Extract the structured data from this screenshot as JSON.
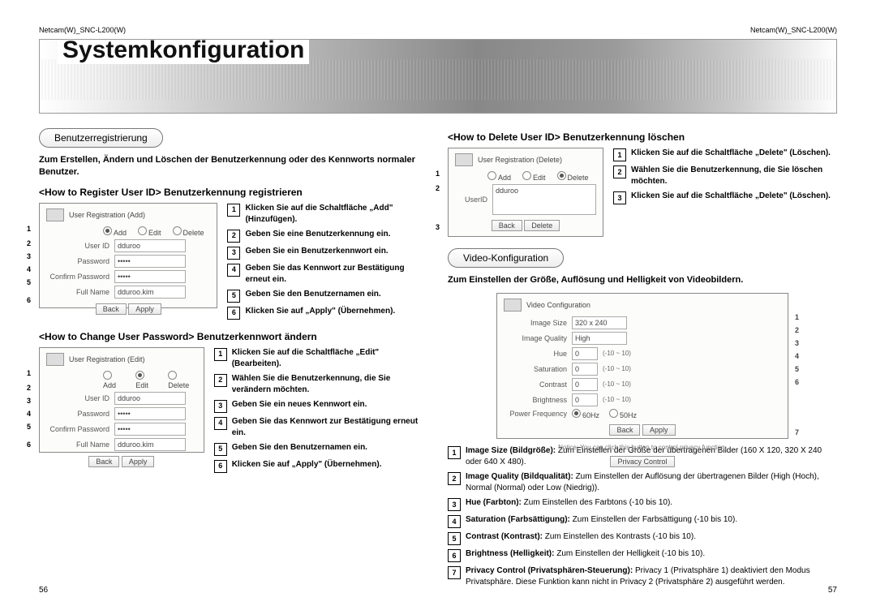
{
  "header": {
    "left": "Netcam(W)_SNC-L200(W)",
    "right": "Netcam(W)_SNC-L200(W)"
  },
  "banner": {
    "title": "Systemkonfiguration"
  },
  "left": {
    "tag": "Benutzerregistrierung",
    "intro": "Zum Erstellen, Ändern und Löschen der Benutzerkennung oder des Kennworts normaler Benutzer.",
    "register": {
      "heading": "<How to Register User ID> Benutzerkennung registrieren",
      "shot": {
        "title": "User Registration (Add)",
        "radios": {
          "add": "Add",
          "edit": "Edit",
          "delete": "Delete"
        },
        "labels": {
          "userid": "User ID",
          "password": "Password",
          "confirm": "Confirm Password",
          "fullname": "Full Name"
        },
        "values": {
          "userid": "dduroo",
          "password": "•••••",
          "confirm": "•••••",
          "fullname": "dduroo.kim"
        },
        "buttons": {
          "back": "Back",
          "apply": "Apply"
        }
      },
      "steps": [
        "Klicken Sie auf die Schaltfläche „Add\" (Hinzufügen).",
        "Geben Sie eine Benutzerkennung ein.",
        "Geben Sie ein Benutzerkennwort ein.",
        "Geben Sie das Kennwort zur Bestätigung erneut ein.",
        "Geben Sie den Benutzernamen ein.",
        "Klicken Sie auf „Apply\" (Übernehmen)."
      ]
    },
    "change": {
      "heading": "<How to Change User Password> Benutzerkennwort ändern",
      "shot": {
        "title": "User Registration (Edit)",
        "radios": {
          "add": "Add",
          "edit": "Edit",
          "delete": "Delete"
        },
        "labels": {
          "userid": "User ID",
          "password": "Password",
          "confirm": "Confirm Password",
          "fullname": "Full Name"
        },
        "values": {
          "userid": "dduroo",
          "password": "•••••",
          "confirm": "•••••",
          "fullname": "dduroo.kim"
        },
        "buttons": {
          "back": "Back",
          "apply": "Apply"
        }
      },
      "steps": [
        "Klicken Sie auf die Schaltfläche „Edit\" (Bearbeiten).",
        "Wählen Sie die Benutzerkennung, die Sie verändern möchten.",
        "Geben Sie ein neues Kennwort ein.",
        "Geben Sie das Kennwort zur Bestätigung erneut ein.",
        "Geben Sie den Benutzernamen ein.",
        "Klicken Sie auf „Apply\" (Übernehmen)."
      ]
    },
    "pagenum": "56"
  },
  "right": {
    "delete": {
      "heading": "<How to Delete User ID> Benutzerkennung löschen",
      "shot": {
        "title": "User Registration (Delete)",
        "radios": {
          "add": "Add",
          "edit": "Edit",
          "delete": "Delete"
        },
        "labels": {
          "userid": "UserID"
        },
        "values": {
          "userid": "dduroo"
        },
        "buttons": {
          "back": "Back",
          "delete": "Delete"
        }
      },
      "steps": [
        "Klicken Sie auf die Schaltfläche „Delete\" (Löschen).",
        "Wählen Sie die Benutzerkennung, die Sie löschen möchten.",
        "Klicken Sie auf die Schaltfläche „Delete\" (Löschen)."
      ]
    },
    "video": {
      "tag": "Video-Konfiguration",
      "intro": "Zum Einstellen der Größe, Auflösung und Helligkeit von Videobildern.",
      "shot": {
        "title": "Video Configuration",
        "labels": {
          "imgsize": "Image Size",
          "imgqual": "Image Quality",
          "hue": "Hue",
          "sat": "Saturation",
          "contrast": "Contrast",
          "bright": "Brightness",
          "pf": "Power Frequency"
        },
        "values": {
          "imgsize": "320 x 240",
          "imgqual": "High",
          "hue": "0",
          "sat": "0",
          "contrast": "0",
          "bright": "0",
          "pf60": "60Hz",
          "pf50": "50Hz"
        },
        "ranges": {
          "r10": "(-10 ~ 10)"
        },
        "buttons": {
          "back": "Back",
          "apply": "Apply",
          "privacy": "Privacy Control"
        },
        "note": "Notice: You can click this button to control privacy function."
      },
      "desc": [
        {
          "t": "Image Size (Bildgröße):",
          "b": "Zum Einstellen der Größe der übertragenen Bilder (160 X 120, 320 X 240 oder 640 X 480)."
        },
        {
          "t": "Image Quality (Bildqualität):",
          "b": "Zum Einstellen der Auflösung der übertragenen Bilder (High (Hoch), Normal (Normal) oder Low (Niedrig))."
        },
        {
          "t": "Hue (Farbton):",
          "b": "Zum Einstellen des Farbtons (-10 bis 10)."
        },
        {
          "t": "Saturation (Farbsättigung):",
          "b": "Zum Einstellen der Farbsättigung (-10 bis 10)."
        },
        {
          "t": "Contrast (Kontrast):",
          "b": "Zum Einstellen des Kontrasts (-10 bis 10)."
        },
        {
          "t": "Brightness (Helligkeit):",
          "b": "Zum Einstellen der Helligkeit (-10 bis 10)."
        },
        {
          "t": "Privacy Control (Privatsphären-Steuerung):",
          "b": "Privacy 1 (Privatsphäre 1) deaktiviert den Modus Privatsphäre. Diese Funktion kann nicht in Privacy 2 (Privatsphäre 2) ausgeführt werden."
        }
      ]
    },
    "pagenum": "57"
  }
}
